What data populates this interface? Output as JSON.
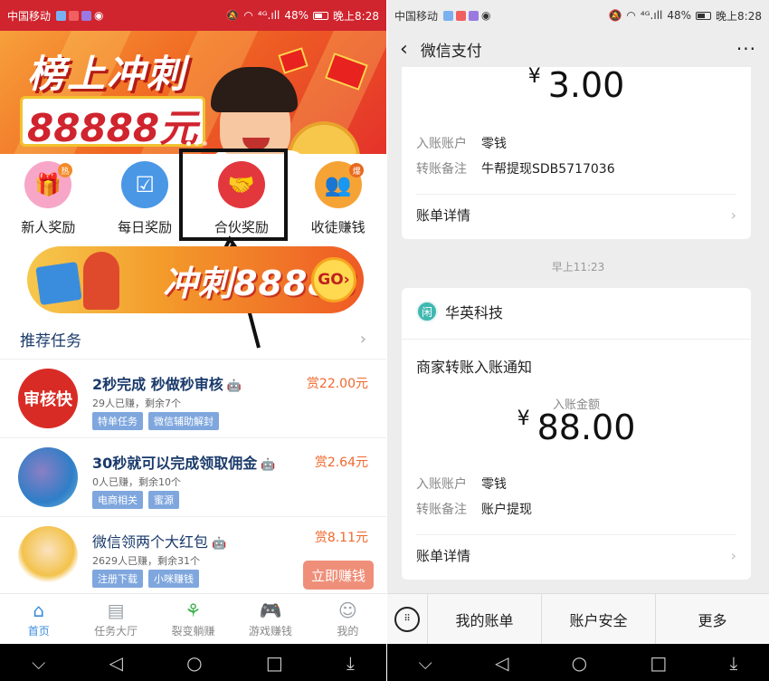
{
  "left": {
    "status": {
      "carrier": "中国移动",
      "network": "⁴ᴳ.ıll",
      "battery": "48%",
      "time": "晚上8:28"
    },
    "banner": {
      "title": "榜上冲刺",
      "amount": "88888元"
    },
    "icons": [
      {
        "label": "新人奖励",
        "badge": "热",
        "color": "#f4a0c4"
      },
      {
        "label": "每日奖励",
        "color": "#4a97e6"
      },
      {
        "label": "合伙奖励",
        "color": "#e3373e"
      },
      {
        "label": "收徒赚钱",
        "badge": "爆",
        "color": "#f6a336"
      }
    ],
    "promo": {
      "text": "冲刺88888元",
      "go": "GO›"
    },
    "recommend": {
      "title": "推荐任务",
      "more": "›"
    },
    "tasks": [
      {
        "name": "2秒完成 秒做秒审核",
        "os": "🤖",
        "sub": "29人已赚，剩余7个",
        "tags": [
          "特单任务",
          "微信辅助解封"
        ],
        "reward": "赏22.00元",
        "avatar_text": "审核快"
      },
      {
        "name": "30秒就可以完成领取佣金",
        "os": "🤖",
        "sub": "0人已赚，剩余10个",
        "tags": [
          "电商相关",
          "蜜源"
        ],
        "reward": "赏2.64元"
      },
      {
        "name": "微信领两个大红包",
        "os": "🤖",
        "sub": "2629人已赚，剩余31个",
        "tags": [
          "注册下载",
          "小咪赚钱"
        ],
        "reward": "赏8.11元",
        "button": "立即赚钱"
      }
    ],
    "tabs": [
      {
        "label": "首页",
        "icon": "⌂",
        "active": true
      },
      {
        "label": "任务大厅",
        "icon": "▤"
      },
      {
        "label": "裂变躺赚",
        "icon": "⚘"
      },
      {
        "label": "游戏赚钱",
        "icon": "🎮"
      },
      {
        "label": "我的",
        "icon": "☺"
      }
    ],
    "nav": [
      "⌵",
      "◁",
      "○",
      "□",
      "⤓"
    ]
  },
  "right": {
    "status": {
      "carrier": "中国移动",
      "network": "⁴ᴳ.ıll",
      "battery": "48%",
      "time": "晚上8:28"
    },
    "header": {
      "back": "‹",
      "title": "微信支付",
      "menu": "···"
    },
    "card1": {
      "yen": "¥",
      "amount": "3.00",
      "account_label": "入账账户",
      "account_value": "零钱",
      "note_label": "转账备注",
      "note_value": "牛帮提现SDB5717036",
      "detail": "账单详情",
      "arrow": "›"
    },
    "time": "早上11:23",
    "card2": {
      "logo": "闲",
      "merchant": "华英科技",
      "notice": "商家转账入账通知",
      "amount_label": "入账金额",
      "yen": "¥",
      "amount": "88.00",
      "account_label": "入账账户",
      "account_value": "零钱",
      "note_label": "转账备注",
      "note_value": "账户提现",
      "detail": "账单详情",
      "arrow": "›"
    },
    "bottom": {
      "keyboard": "⠿",
      "items": [
        "我的账单",
        "账户安全",
        "更多"
      ]
    },
    "nav": [
      "⌵",
      "◁",
      "○",
      "□",
      "⤓"
    ]
  }
}
